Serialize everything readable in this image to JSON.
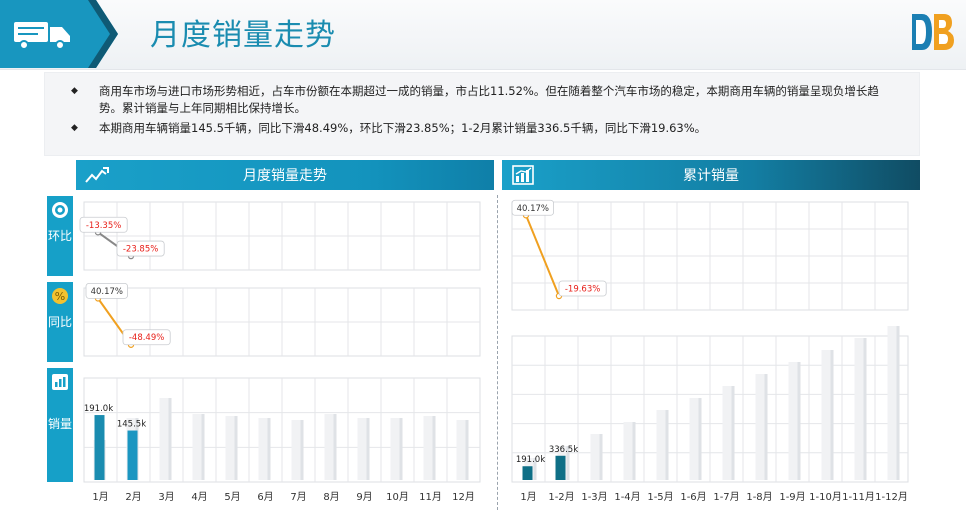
{
  "header": {
    "title": "月度销量走势"
  },
  "bullets": [
    "商用车市场与进口市场形势相近，占车市份额在本期超过一成的销量，市占比11.52%。但在随着整个汽车市场的稳定，本期商用车辆的销量呈现负增长趋势。累计销量与上年同期相比保持增长。",
    "本期商用车辆销量145.5千辆，同比下滑48.49%，环比下滑23.85%；1-2月累计销量336.5千辆，同比下滑19.63%。"
  ],
  "panels": {
    "left_title": "月度销量走势",
    "right_title": "累计销量"
  },
  "side_tabs": {
    "mom": "环比",
    "yoy": "同比",
    "sales": "销量"
  },
  "colors": {
    "accent": "#16a0c8",
    "bar_dark": "#1a8cb0",
    "bar_teal": "#0f6f86",
    "negative": "#e8201a",
    "line_gray": "#888888",
    "line_orange": "#f0a020"
  },
  "chart_data": [
    {
      "id": "monthly",
      "type": "bar",
      "categories": [
        "1月",
        "2月",
        "3月",
        "4月",
        "5月",
        "6月",
        "7月",
        "8月",
        "9月",
        "10月",
        "11月",
        "12月"
      ],
      "series": [
        {
          "values": [
            191.0,
            145.5,
            null,
            null,
            null,
            null,
            null,
            null,
            null,
            null,
            null,
            null
          ],
          "labels": [
            "191.0k",
            "145.5k"
          ]
        }
      ]
    },
    {
      "id": "mom",
      "type": "line",
      "categories": [
        "1月",
        "2月"
      ],
      "values": [
        -13.35,
        -23.85
      ],
      "labels": [
        "-13.35%",
        "-23.85%"
      ]
    },
    {
      "id": "yoy",
      "type": "line",
      "categories": [
        "1月",
        "2月"
      ],
      "values": [
        40.17,
        -48.49
      ],
      "labels": [
        "40.17%",
        "-48.49%"
      ]
    },
    {
      "id": "cumulative",
      "type": "bar",
      "categories": [
        "1月",
        "1-2月",
        "1-3月",
        "1-4月",
        "1-5月",
        "1-6月",
        "1-7月",
        "1-8月",
        "1-9月",
        "1-10月",
        "1-11月",
        "1-12月"
      ],
      "series": [
        {
          "values": [
            191.0,
            336.5,
            null,
            null,
            null,
            null,
            null,
            null,
            null,
            null,
            null,
            null
          ],
          "labels": [
            "191.0k",
            "336.5k"
          ]
        }
      ]
    },
    {
      "id": "cumulative_yoy",
      "type": "line",
      "categories": [
        "1月",
        "1-2月"
      ],
      "values": [
        40.17,
        -19.63
      ],
      "labels": [
        "40.17%",
        "-19.63%"
      ]
    }
  ]
}
